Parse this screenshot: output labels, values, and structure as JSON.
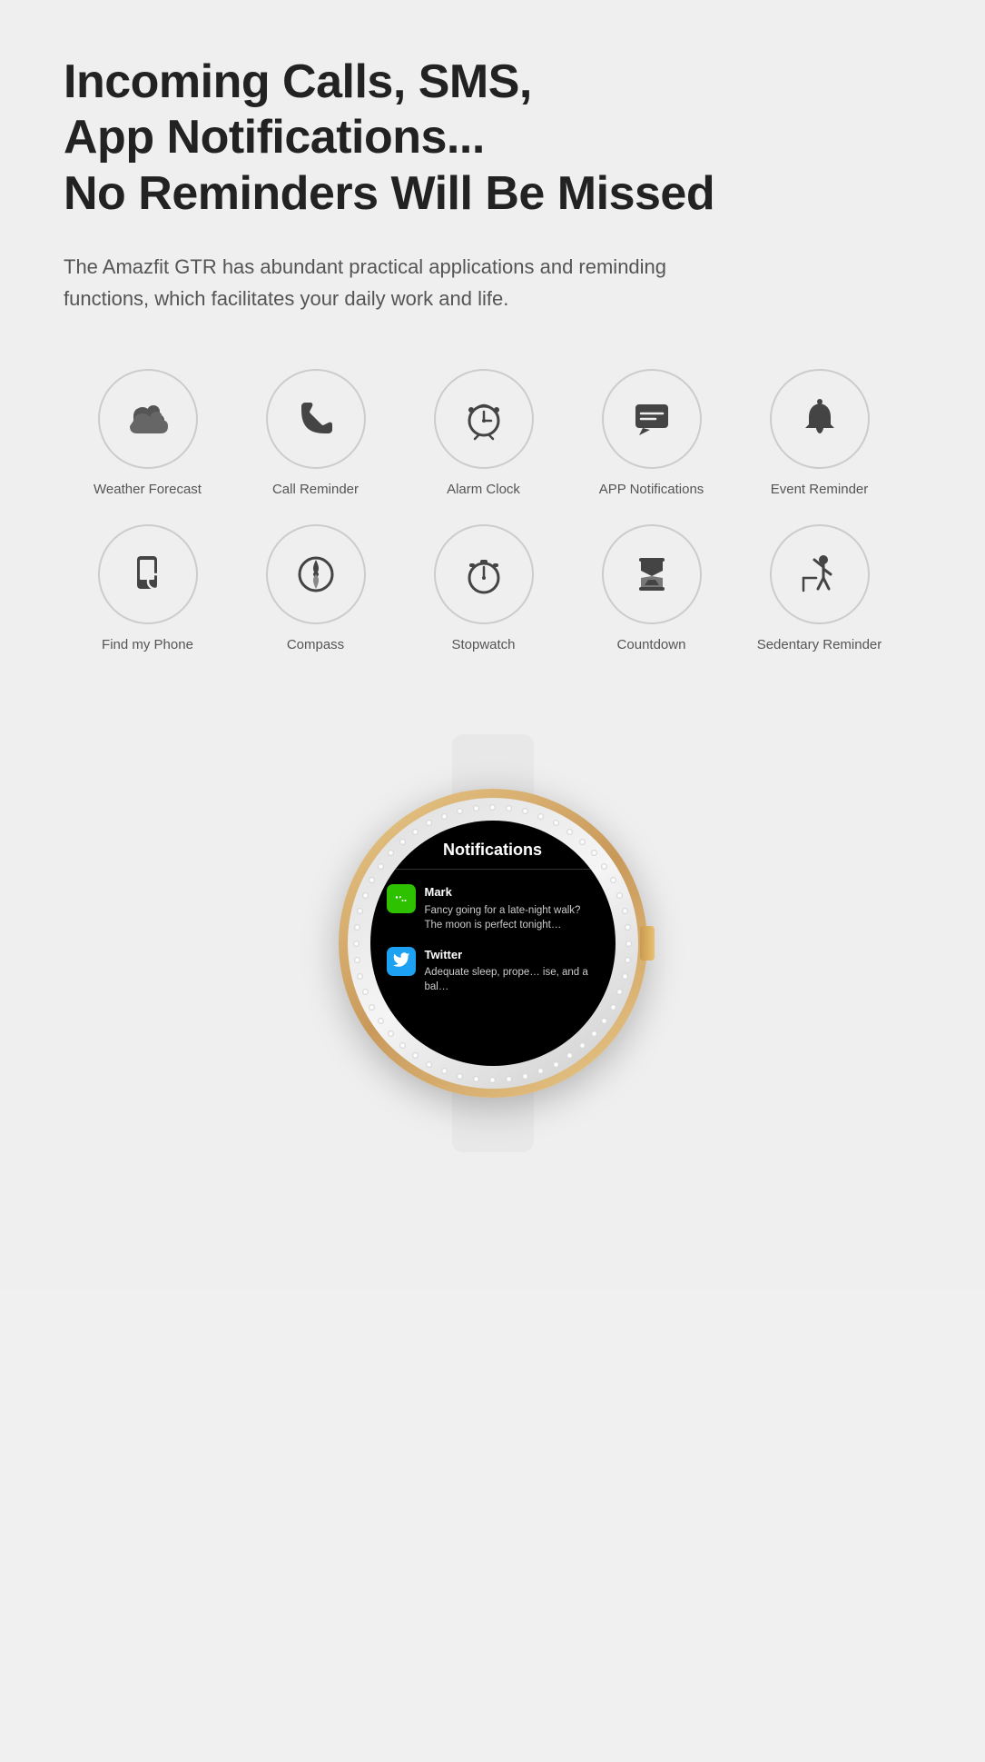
{
  "headline": {
    "line1": "Incoming Calls, SMS,",
    "line2": "App Notifications...",
    "line3": "No Reminders Will Be Missed"
  },
  "subtitle": "The Amazfit GTR has abundant practical applications and reminding functions, which facilitates your daily work and life.",
  "row1": [
    {
      "id": "weather-forecast",
      "label": "Weather Forecast",
      "icon": "weather"
    },
    {
      "id": "call-reminder",
      "label": "Call Reminder",
      "icon": "call"
    },
    {
      "id": "alarm-clock",
      "label": "Alarm Clock",
      "icon": "alarm"
    },
    {
      "id": "app-notifications",
      "label": "APP Notifications",
      "icon": "notification"
    },
    {
      "id": "event-reminder",
      "label": "Event Reminder",
      "icon": "event"
    }
  ],
  "row2": [
    {
      "id": "find-my-phone",
      "label": "Find my Phone",
      "icon": "findphone"
    },
    {
      "id": "compass",
      "label": "Compass",
      "icon": "compass"
    },
    {
      "id": "stopwatch",
      "label": "Stopwatch",
      "icon": "stopwatch"
    },
    {
      "id": "countdown",
      "label": "Countdown",
      "icon": "countdown"
    },
    {
      "id": "sedentary-reminder",
      "label": "Sedentary Reminder",
      "icon": "sedentary"
    }
  ],
  "watch": {
    "screen_title": "Notifications",
    "notifications": [
      {
        "app": "Mark",
        "app_icon": "wechat",
        "message": "Fancy going for a late-night walk? The moon is perfect tonight…"
      },
      {
        "app": "Twitter",
        "app_icon": "twitter",
        "message": "Adequate sleep, prope… ise, and a bal…"
      }
    ]
  }
}
